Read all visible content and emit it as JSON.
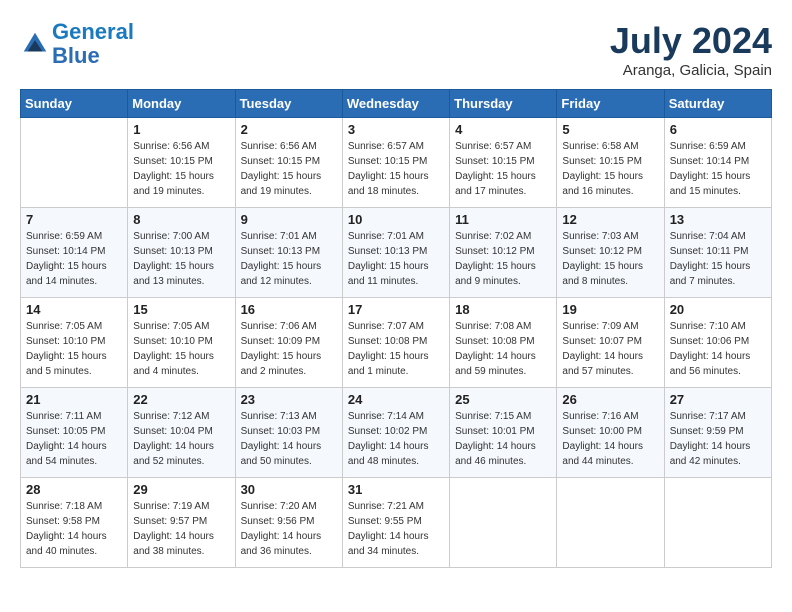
{
  "header": {
    "logo_line1": "General",
    "logo_line2": "Blue",
    "month": "July 2024",
    "location": "Aranga, Galicia, Spain"
  },
  "weekdays": [
    "Sunday",
    "Monday",
    "Tuesday",
    "Wednesday",
    "Thursday",
    "Friday",
    "Saturday"
  ],
  "weeks": [
    [
      {
        "day": "",
        "sunrise": "",
        "sunset": "",
        "daylight": ""
      },
      {
        "day": "1",
        "sunrise": "Sunrise: 6:56 AM",
        "sunset": "Sunset: 10:15 PM",
        "daylight": "Daylight: 15 hours and 19 minutes."
      },
      {
        "day": "2",
        "sunrise": "Sunrise: 6:56 AM",
        "sunset": "Sunset: 10:15 PM",
        "daylight": "Daylight: 15 hours and 19 minutes."
      },
      {
        "day": "3",
        "sunrise": "Sunrise: 6:57 AM",
        "sunset": "Sunset: 10:15 PM",
        "daylight": "Daylight: 15 hours and 18 minutes."
      },
      {
        "day": "4",
        "sunrise": "Sunrise: 6:57 AM",
        "sunset": "Sunset: 10:15 PM",
        "daylight": "Daylight: 15 hours and 17 minutes."
      },
      {
        "day": "5",
        "sunrise": "Sunrise: 6:58 AM",
        "sunset": "Sunset: 10:15 PM",
        "daylight": "Daylight: 15 hours and 16 minutes."
      },
      {
        "day": "6",
        "sunrise": "Sunrise: 6:59 AM",
        "sunset": "Sunset: 10:14 PM",
        "daylight": "Daylight: 15 hours and 15 minutes."
      }
    ],
    [
      {
        "day": "7",
        "sunrise": "Sunrise: 6:59 AM",
        "sunset": "Sunset: 10:14 PM",
        "daylight": "Daylight: 15 hours and 14 minutes."
      },
      {
        "day": "8",
        "sunrise": "Sunrise: 7:00 AM",
        "sunset": "Sunset: 10:13 PM",
        "daylight": "Daylight: 15 hours and 13 minutes."
      },
      {
        "day": "9",
        "sunrise": "Sunrise: 7:01 AM",
        "sunset": "Sunset: 10:13 PM",
        "daylight": "Daylight: 15 hours and 12 minutes."
      },
      {
        "day": "10",
        "sunrise": "Sunrise: 7:01 AM",
        "sunset": "Sunset: 10:13 PM",
        "daylight": "Daylight: 15 hours and 11 minutes."
      },
      {
        "day": "11",
        "sunrise": "Sunrise: 7:02 AM",
        "sunset": "Sunset: 10:12 PM",
        "daylight": "Daylight: 15 hours and 9 minutes."
      },
      {
        "day": "12",
        "sunrise": "Sunrise: 7:03 AM",
        "sunset": "Sunset: 10:12 PM",
        "daylight": "Daylight: 15 hours and 8 minutes."
      },
      {
        "day": "13",
        "sunrise": "Sunrise: 7:04 AM",
        "sunset": "Sunset: 10:11 PM",
        "daylight": "Daylight: 15 hours and 7 minutes."
      }
    ],
    [
      {
        "day": "14",
        "sunrise": "Sunrise: 7:05 AM",
        "sunset": "Sunset: 10:10 PM",
        "daylight": "Daylight: 15 hours and 5 minutes."
      },
      {
        "day": "15",
        "sunrise": "Sunrise: 7:05 AM",
        "sunset": "Sunset: 10:10 PM",
        "daylight": "Daylight: 15 hours and 4 minutes."
      },
      {
        "day": "16",
        "sunrise": "Sunrise: 7:06 AM",
        "sunset": "Sunset: 10:09 PM",
        "daylight": "Daylight: 15 hours and 2 minutes."
      },
      {
        "day": "17",
        "sunrise": "Sunrise: 7:07 AM",
        "sunset": "Sunset: 10:08 PM",
        "daylight": "Daylight: 15 hours and 1 minute."
      },
      {
        "day": "18",
        "sunrise": "Sunrise: 7:08 AM",
        "sunset": "Sunset: 10:08 PM",
        "daylight": "Daylight: 14 hours and 59 minutes."
      },
      {
        "day": "19",
        "sunrise": "Sunrise: 7:09 AM",
        "sunset": "Sunset: 10:07 PM",
        "daylight": "Daylight: 14 hours and 57 minutes."
      },
      {
        "day": "20",
        "sunrise": "Sunrise: 7:10 AM",
        "sunset": "Sunset: 10:06 PM",
        "daylight": "Daylight: 14 hours and 56 minutes."
      }
    ],
    [
      {
        "day": "21",
        "sunrise": "Sunrise: 7:11 AM",
        "sunset": "Sunset: 10:05 PM",
        "daylight": "Daylight: 14 hours and 54 minutes."
      },
      {
        "day": "22",
        "sunrise": "Sunrise: 7:12 AM",
        "sunset": "Sunset: 10:04 PM",
        "daylight": "Daylight: 14 hours and 52 minutes."
      },
      {
        "day": "23",
        "sunrise": "Sunrise: 7:13 AM",
        "sunset": "Sunset: 10:03 PM",
        "daylight": "Daylight: 14 hours and 50 minutes."
      },
      {
        "day": "24",
        "sunrise": "Sunrise: 7:14 AM",
        "sunset": "Sunset: 10:02 PM",
        "daylight": "Daylight: 14 hours and 48 minutes."
      },
      {
        "day": "25",
        "sunrise": "Sunrise: 7:15 AM",
        "sunset": "Sunset: 10:01 PM",
        "daylight": "Daylight: 14 hours and 46 minutes."
      },
      {
        "day": "26",
        "sunrise": "Sunrise: 7:16 AM",
        "sunset": "Sunset: 10:00 PM",
        "daylight": "Daylight: 14 hours and 44 minutes."
      },
      {
        "day": "27",
        "sunrise": "Sunrise: 7:17 AM",
        "sunset": "Sunset: 9:59 PM",
        "daylight": "Daylight: 14 hours and 42 minutes."
      }
    ],
    [
      {
        "day": "28",
        "sunrise": "Sunrise: 7:18 AM",
        "sunset": "Sunset: 9:58 PM",
        "daylight": "Daylight: 14 hours and 40 minutes."
      },
      {
        "day": "29",
        "sunrise": "Sunrise: 7:19 AM",
        "sunset": "Sunset: 9:57 PM",
        "daylight": "Daylight: 14 hours and 38 minutes."
      },
      {
        "day": "30",
        "sunrise": "Sunrise: 7:20 AM",
        "sunset": "Sunset: 9:56 PM",
        "daylight": "Daylight: 14 hours and 36 minutes."
      },
      {
        "day": "31",
        "sunrise": "Sunrise: 7:21 AM",
        "sunset": "Sunset: 9:55 PM",
        "daylight": "Daylight: 14 hours and 34 minutes."
      },
      {
        "day": "",
        "sunrise": "",
        "sunset": "",
        "daylight": ""
      },
      {
        "day": "",
        "sunrise": "",
        "sunset": "",
        "daylight": ""
      },
      {
        "day": "",
        "sunrise": "",
        "sunset": "",
        "daylight": ""
      }
    ]
  ]
}
